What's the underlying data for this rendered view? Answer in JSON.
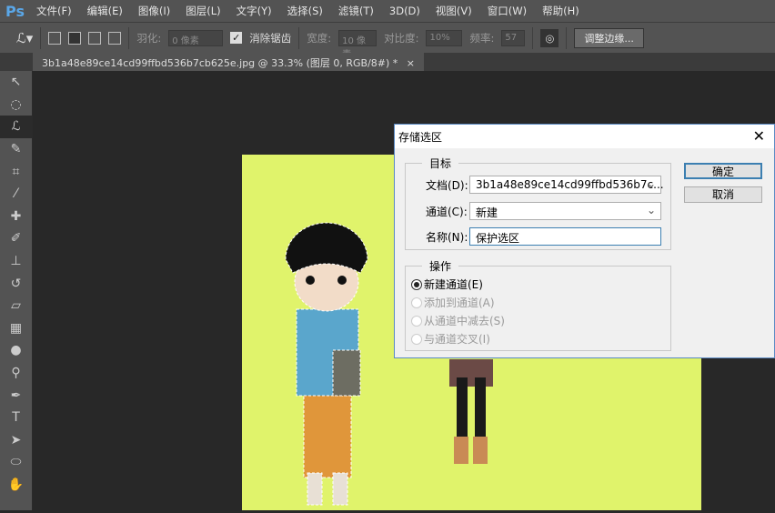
{
  "app": {
    "logo": "Ps"
  },
  "menu": [
    "文件(F)",
    "编辑(E)",
    "图像(I)",
    "图层(L)",
    "文字(Y)",
    "选择(S)",
    "滤镜(T)",
    "3D(D)",
    "视图(V)",
    "窗口(W)",
    "帮助(H)"
  ],
  "options": {
    "feather_label": "羽化:",
    "feather_value": "0 像素",
    "antialias_label": "消除锯齿",
    "antialias_checked": true,
    "width_label": "宽度:",
    "width_value": "10 像素",
    "contrast_label": "对比度:",
    "contrast_value": "10%",
    "frequency_label": "频率:",
    "frequency_value": "57",
    "refine_edge": "调整边缘..."
  },
  "document_tab": {
    "title": "3b1a48e89ce14cd99ffbd536b7cb625e.jpg @ 33.3% (图层 0, RGB/8#) *",
    "close": "×"
  },
  "tools": [
    "move",
    "marquee",
    "magnetic-lasso",
    "quick-select",
    "crop",
    "eyedropper",
    "healing",
    "brush",
    "stamp",
    "history-brush",
    "eraser",
    "gradient",
    "blur",
    "dodge",
    "pen",
    "type",
    "path-select",
    "ellipse",
    "hand"
  ],
  "canvas": {
    "background": "#e0f36b"
  },
  "dialog": {
    "title": "存储选区",
    "close": "✕",
    "target_legend": "目标",
    "document_label": "文档(D):",
    "document_value": "3b1a48e89ce14cd99ffbd536b7c...",
    "channel_label": "通道(C):",
    "channel_value": "新建",
    "name_label": "名称(N):",
    "name_value": "保护选区",
    "operation_legend": "操作",
    "operations": [
      {
        "label": "新建通道(E)",
        "selected": true,
        "enabled": true
      },
      {
        "label": "添加到通道(A)",
        "selected": false,
        "enabled": false
      },
      {
        "label": "从通道中减去(S)",
        "selected": false,
        "enabled": false
      },
      {
        "label": "与通道交叉(I)",
        "selected": false,
        "enabled": false
      }
    ],
    "ok": "确定",
    "cancel": "取消"
  }
}
